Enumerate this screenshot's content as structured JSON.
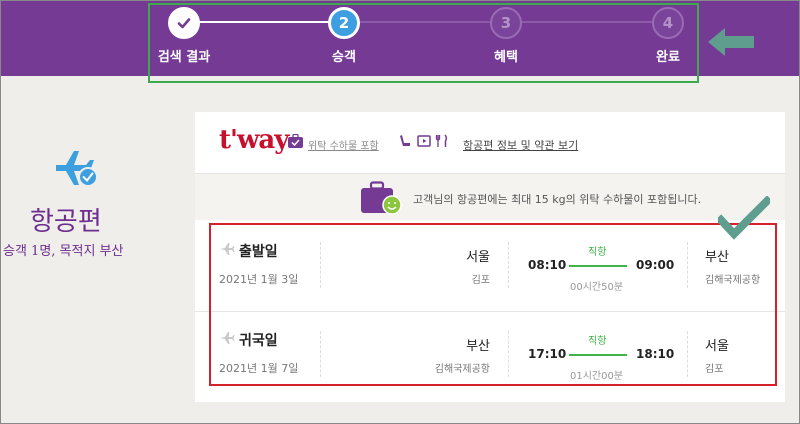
{
  "stepper": {
    "steps": [
      {
        "number": "",
        "label": "검색 결과",
        "state": "done"
      },
      {
        "number": "2",
        "label": "승객",
        "state": "active"
      },
      {
        "number": "3",
        "label": "혜택",
        "state": "todo"
      },
      {
        "number": "4",
        "label": "완료",
        "state": "todo"
      }
    ]
  },
  "sidebar": {
    "icon": "plane-check-icon",
    "title": "항공편",
    "subtitle": "승객 1명, 목적지 부산"
  },
  "card": {
    "airline_logo": "t'way",
    "baggage_link": "위탁 수하물 포함",
    "amenity_icons": [
      "seat-icon",
      "media-icon",
      "meal-icon"
    ],
    "info_link": "항공편 정보 및 약관 보기",
    "notice": "고객님의 항공편에는 최대 15 kg의 위탁 수하물이 포함됩니다."
  },
  "flights": [
    {
      "title": "출발일",
      "date": "2021년 1월 3일",
      "from_city": "서울",
      "from_airport": "김포",
      "dep_time": "08:10",
      "arr_time": "09:00",
      "type": "직항",
      "duration": "00시간50분",
      "to_city": "부산",
      "to_airport": "김해국제공항"
    },
    {
      "title": "귀국일",
      "date": "2021년 1월 7일",
      "from_city": "부산",
      "from_airport": "김해국제공항",
      "dep_time": "17:10",
      "arr_time": "18:10",
      "type": "직항",
      "duration": "01시간00분",
      "to_city": "서울",
      "to_airport": "김포"
    }
  ],
  "colors": {
    "header": "#743a94",
    "step_active": "#3d9fe0",
    "direct": "#3eb449",
    "logo": "#c8102e",
    "highlight_green": "#3cab4e",
    "highlight_red": "#d6202a",
    "annotation_arrow": "#5f9e8f"
  }
}
